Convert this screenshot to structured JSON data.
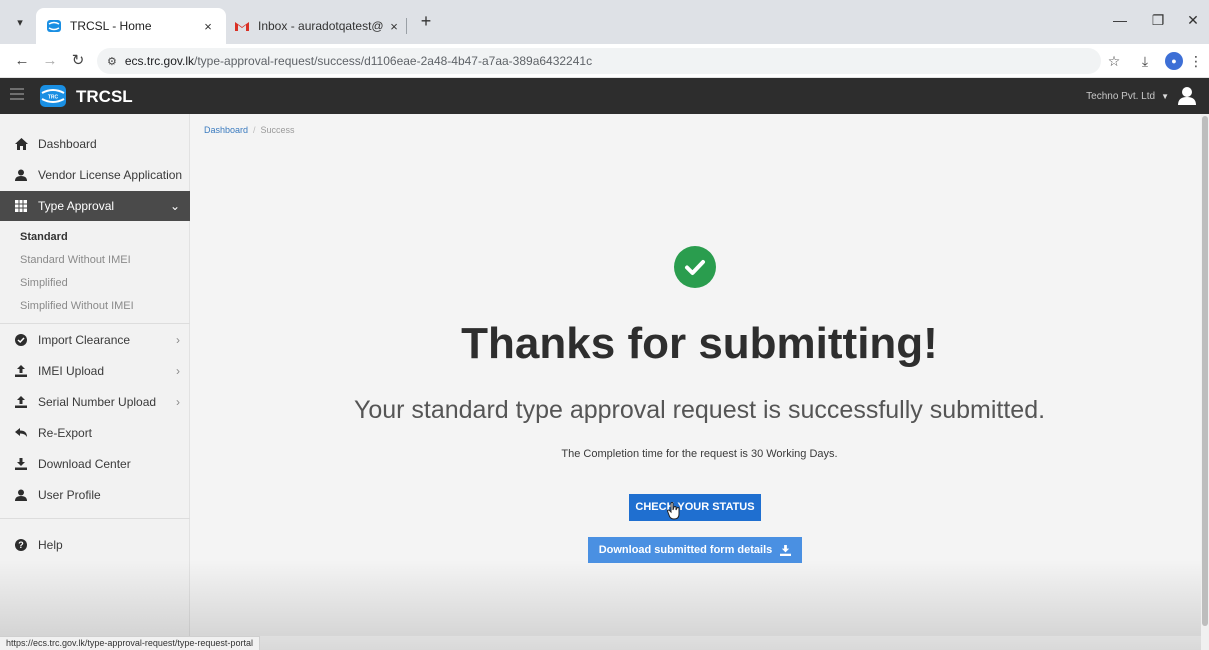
{
  "browser": {
    "tabs": [
      {
        "title": "TRCSL - Home",
        "active": true,
        "close": "×"
      },
      {
        "title": "Inbox - auradotqatest@gmail.c",
        "active": false,
        "close": "×"
      }
    ],
    "new_tab": "+",
    "url_host": "ecs.trc.gov.lk",
    "url_path": "/type-approval-request/success/d1106eae-2a48-4b47-a7aa-389a6432241c",
    "status_url": "https://ecs.trc.gov.lk/type-approval-request/type-request-portal"
  },
  "app": {
    "brand": "TRCSL",
    "logo_text": "TRC",
    "user_name": "Techno Pvt. Ltd"
  },
  "sidebar": {
    "items": [
      {
        "label": "Dashboard",
        "icon": "home-icon"
      },
      {
        "label": "Vendor License Application",
        "icon": "user-icon"
      },
      {
        "label": "Type Approval",
        "icon": "table-icon",
        "active": true,
        "expanded": true
      },
      {
        "label": "Import Clearance",
        "icon": "check-circle-icon"
      },
      {
        "label": "IMEI Upload",
        "icon": "upload-icon"
      },
      {
        "label": "Serial Number Upload",
        "icon": "upload-icon"
      },
      {
        "label": "Re-Export",
        "icon": "reply-icon"
      },
      {
        "label": "Download Center",
        "icon": "download-icon"
      },
      {
        "label": "User Profile",
        "icon": "user-icon"
      },
      {
        "label": "Help",
        "icon": "question-icon"
      }
    ],
    "submenu": [
      {
        "label": "Standard",
        "current": true
      },
      {
        "label": "Standard Without IMEI"
      },
      {
        "label": "Simplified"
      },
      {
        "label": "Simplified Without IMEI"
      }
    ]
  },
  "breadcrumb": {
    "home": "Dashboard",
    "separator": "/",
    "current": "Success"
  },
  "main": {
    "heading": "Thanks for submitting!",
    "subheading": "Your standard type approval request is successfully submitted.",
    "info": "The Completion time for the request is 30 Working Days.",
    "check_status_label": "CHECK YOUR STATUS",
    "download_label": "Download submitted form details"
  },
  "colors": {
    "header_bg": "#2d2d2d",
    "success_green": "#2a9d4e",
    "primary_blue": "#1f6fd0",
    "secondary_blue": "#4a90e2",
    "sidebar_active": "#4a4a4a"
  }
}
